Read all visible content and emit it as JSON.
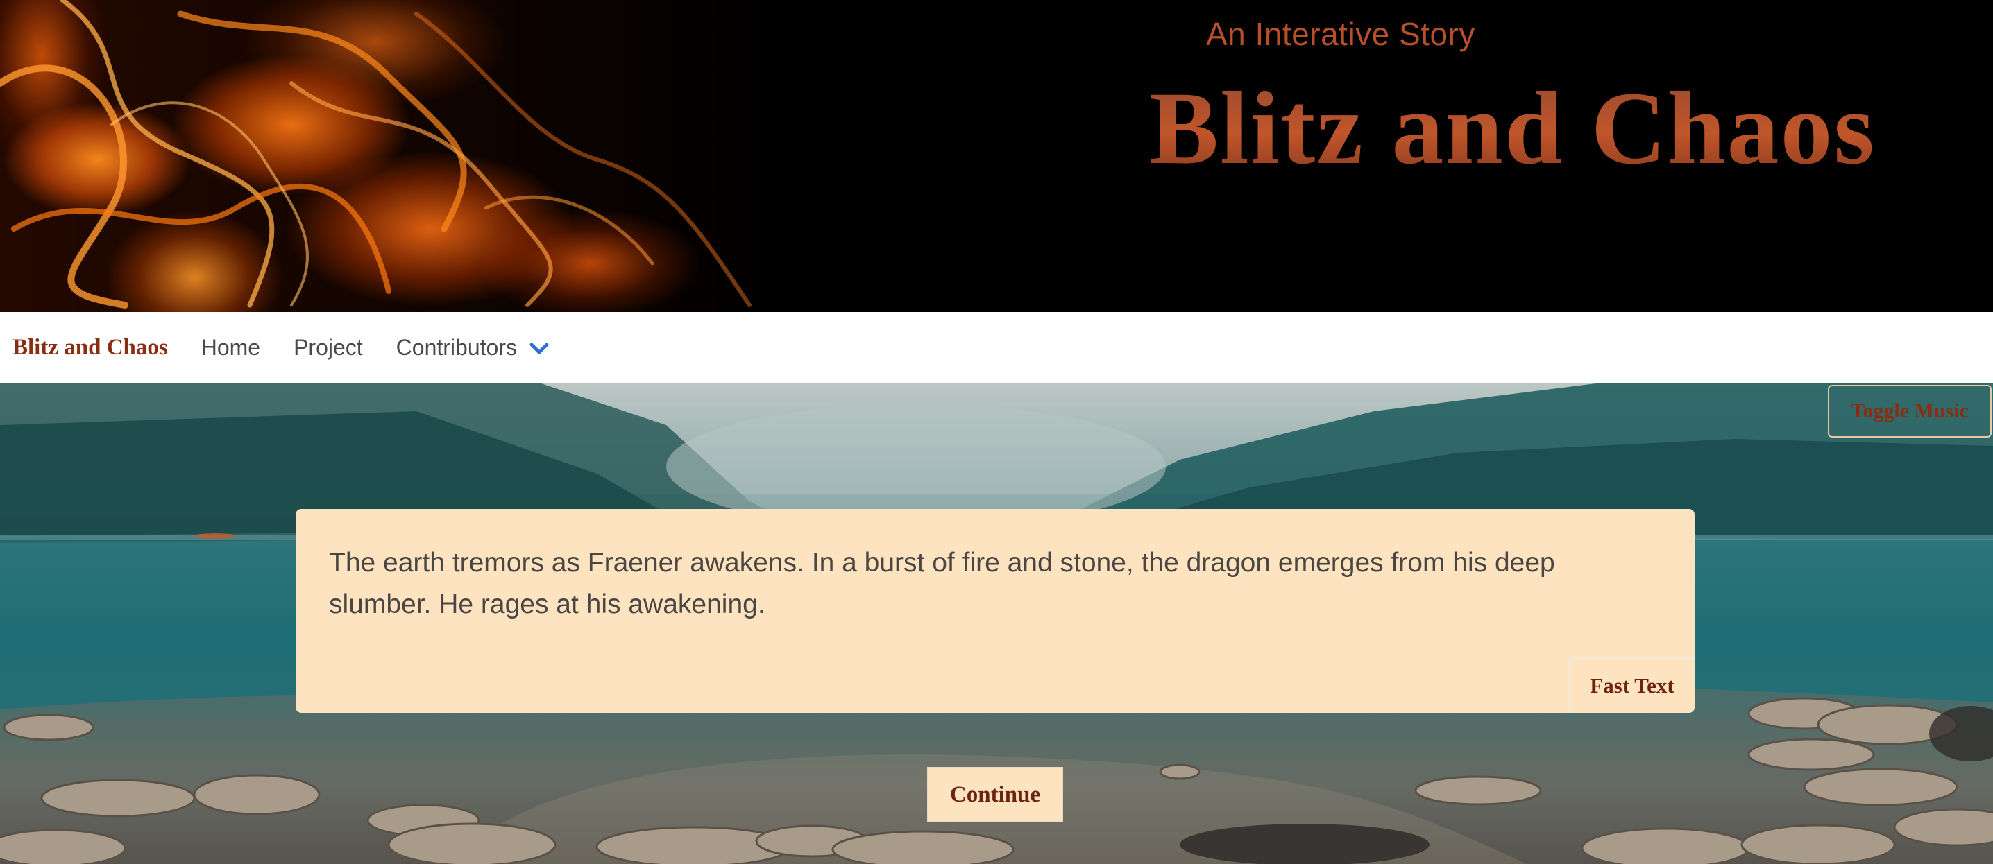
{
  "banner": {
    "subtitle": "An Interative Story",
    "title": "Blitz and Chaos"
  },
  "nav": {
    "brand": "Blitz and Chaos",
    "links": [
      "Home",
      "Project",
      "Contributors"
    ],
    "dropdown_icon": "chevron-down-icon"
  },
  "controls": {
    "toggle_music": "Toggle Music",
    "fast_text": "Fast Text",
    "continue": "Continue"
  },
  "story": {
    "text": "The earth tremors as Fraener awakens. In a burst of fire and stone, the dragon emerges from his deep slumber. He rages at his awakening."
  },
  "colors": {
    "accent": "#8a2e12",
    "story_box": "#fde3bf",
    "nav_bg": "#ffffff",
    "chevron": "#2f6fd6"
  }
}
